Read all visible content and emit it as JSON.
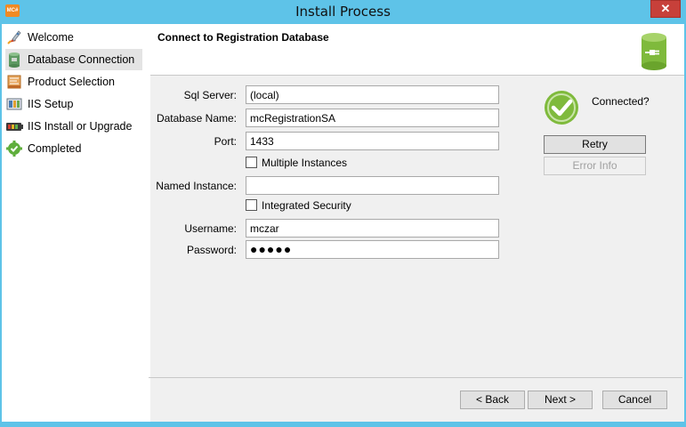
{
  "window": {
    "title": "Install Process",
    "app_icon_text": "MC#",
    "close_glyph": "✕"
  },
  "sidebar": {
    "items": [
      {
        "label": "Welcome",
        "icon": "rocket-icon"
      },
      {
        "label": "Database Connection",
        "icon": "database-icon",
        "selected": true
      },
      {
        "label": "Product Selection",
        "icon": "product-box-icon"
      },
      {
        "label": "IIS Setup",
        "icon": "iis-setup-icon"
      },
      {
        "label": "IIS Install or Upgrade",
        "icon": "battery-icon"
      },
      {
        "label": "Completed",
        "icon": "gear-check-icon"
      }
    ]
  },
  "header": {
    "title": "Connect to Registration Database",
    "icon": "database-plug-icon"
  },
  "form": {
    "sql_server": {
      "label": "Sql Server:",
      "value": "(local)"
    },
    "database_name": {
      "label": "Database Name:",
      "value": "mcRegistrationSA"
    },
    "port": {
      "label": "Port:",
      "value": "1433"
    },
    "multiple_instances": {
      "label": "Multiple Instances",
      "checked": false
    },
    "named_instance": {
      "label": "Named Instance:",
      "value": ""
    },
    "integrated_security": {
      "label": "Integrated Security",
      "checked": false
    },
    "username": {
      "label": "Username:",
      "value": "mczar"
    },
    "password": {
      "label": "Password:",
      "value": "●●●●●"
    }
  },
  "connection": {
    "status_label": "Connected?",
    "status_icon": "check-circle-icon",
    "status_color": "#7fba3c",
    "retry_label": "Retry",
    "error_info_label": "Error Info"
  },
  "footer": {
    "back_label": "< Back",
    "next_label": "Next >",
    "cancel_label": "Cancel"
  },
  "colors": {
    "frame": "#5ec3e8",
    "close": "#c7403a",
    "accent_green": "#7fba3c"
  }
}
